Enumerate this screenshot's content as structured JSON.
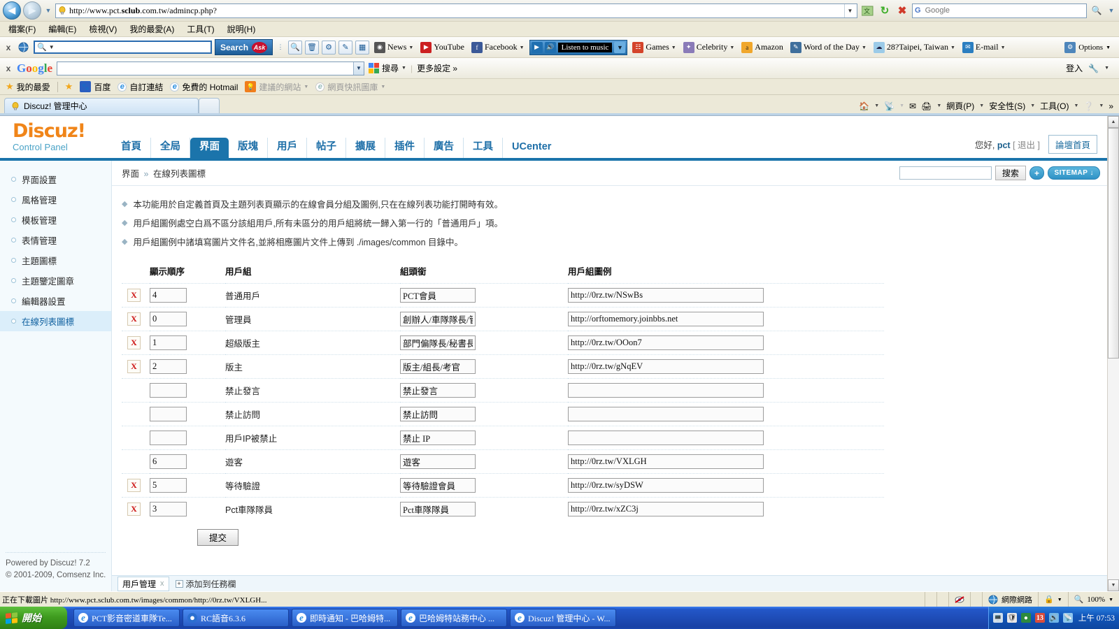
{
  "browser": {
    "address": {
      "url_prefix": "http://www.pct.",
      "url_bold": "sclub",
      "url_suffix": ".com.tw/admincp.php?"
    },
    "ie_search_placeholder": "Google",
    "menus": [
      "檔案(F)",
      "編輯(E)",
      "檢視(V)",
      "我的最愛(A)",
      "工具(T)",
      "說明(H)"
    ],
    "ask_toolbar": {
      "close": "x",
      "search_button": "Search",
      "ask_logo": "Ask",
      "items": [
        {
          "label": "News"
        },
        {
          "label": "YouTube"
        },
        {
          "label": "Facebook"
        }
      ],
      "music_label": "Listen to music",
      "items2": [
        {
          "label": "Games"
        },
        {
          "label": "Celebrity"
        },
        {
          "label": "Amazon"
        },
        {
          "label": "Word of the Day"
        },
        {
          "label": "28?Taipei, Taiwan"
        },
        {
          "label": "E-mail"
        }
      ],
      "options": "Options"
    },
    "google_toolbar": {
      "close": "x",
      "logo": "Google",
      "search_label": "搜尋",
      "more_label": "更多設定 »",
      "signin": "登入"
    },
    "favorites": {
      "label": "我的最愛",
      "items": [
        {
          "label": "百度"
        },
        {
          "label": "自訂連結"
        },
        {
          "label": "免費的 Hotmail"
        },
        {
          "label": "建議的網站"
        },
        {
          "label": "網頁快訊圖庫"
        }
      ]
    },
    "tab": {
      "title": "Discuz! 管理中心"
    },
    "command_bar": [
      "網頁(P)",
      "安全性(S)",
      "工具(O)"
    ],
    "statusbar": {
      "text": "正在下載圖片 http://www.pct.sclub.com.tw/images/common/http://0rz.tw/VXLGH...",
      "zone": "網際網路",
      "zoom": "100%"
    }
  },
  "discuz": {
    "logo_title": "Discuz!",
    "logo_sub": "Control Panel",
    "tabs": [
      {
        "label": "首頁",
        "active": false
      },
      {
        "label": "全局",
        "active": false
      },
      {
        "label": "界面",
        "active": true
      },
      {
        "label": "版塊",
        "active": false
      },
      {
        "label": "用戶",
        "active": false
      },
      {
        "label": "帖子",
        "active": false
      },
      {
        "label": "擴展",
        "active": false
      },
      {
        "label": "插件",
        "active": false
      },
      {
        "label": "廣告",
        "active": false
      },
      {
        "label": "工具",
        "active": false
      },
      {
        "label": "UCenter",
        "active": false
      }
    ],
    "user": {
      "greeting": "您好,",
      "name": "pct",
      "logout": "[ 退出 ]",
      "forum_home": "論壇首頁"
    },
    "breadcrumb": {
      "root": "界面",
      "sep": "»",
      "current": "在線列表圖標"
    },
    "search": {
      "value": "",
      "button": "搜索",
      "plus": "+",
      "sitemap": "SITEMAP ↓"
    },
    "sidebar": {
      "items": [
        {
          "label": "界面設置",
          "active": false
        },
        {
          "label": "風格管理",
          "active": false
        },
        {
          "label": "模板管理",
          "active": false
        },
        {
          "label": "表情管理",
          "active": false
        },
        {
          "label": "主題圖標",
          "active": false
        },
        {
          "label": "主題鑒定圖章",
          "active": false
        },
        {
          "label": "編輯器設置",
          "active": false
        },
        {
          "label": "在線列表圖標",
          "active": true
        }
      ],
      "footer_line1": "Powered by Discuz! 7.2",
      "footer_line2": "© 2001-2009, Comsenz Inc."
    },
    "notes": [
      "本功能用於自定義首頁及主題列表頁顯示的在線會員分組及圖例,只在在線列表功能打開時有效。",
      "用戶組圖例處空白爲不區分該組用戶,所有未區分的用戶組將統一歸入第一行的「普通用戶」項。",
      "用戶組圖例中諸填寫圖片文件名,並將相應圖片文件上傳到 ./images/common 目錄中。"
    ],
    "table": {
      "headers": {
        "del": "",
        "order": "顯示順序",
        "group": "用戶組",
        "title": "組頭銜",
        "icon": "用戶組圖例"
      },
      "rows": [
        {
          "deletable": true,
          "order": "4",
          "group": "普通用戶",
          "title": "PCT會員",
          "icon": "http://0rz.tw/NSwBs"
        },
        {
          "deletable": true,
          "order": "0",
          "group": "管理員",
          "title": "創辦人/車隊隊長/管",
          "icon": "http://orftomemory.joinbbs.net"
        },
        {
          "deletable": true,
          "order": "1",
          "group": "超級版主",
          "title": "部門偏隊長/秘書長",
          "icon": "http://0rz.tw/OOon7"
        },
        {
          "deletable": true,
          "order": "2",
          "group": "版主",
          "title": "版主/組長/考官",
          "icon": "http://0rz.tw/gNqEV"
        },
        {
          "deletable": false,
          "order": "",
          "group": "禁止發言",
          "title": "禁止發言",
          "icon": ""
        },
        {
          "deletable": false,
          "order": "",
          "group": "禁止訪問",
          "title": "禁止訪問",
          "icon": ""
        },
        {
          "deletable": false,
          "order": "",
          "group": "用戶IP被禁止",
          "title": "禁止 IP",
          "icon": ""
        },
        {
          "deletable": false,
          "order": "6",
          "group": "遊客",
          "title": "遊客",
          "icon": "http://0rz.tw/VXLGH"
        },
        {
          "deletable": true,
          "order": "5",
          "group": "等待驗證",
          "title": "等待驗證會員",
          "icon": "http://0rz.tw/syDSW"
        },
        {
          "deletable": true,
          "order": "3",
          "group": "Pct車隊隊員",
          "title": "Pct車隊隊員",
          "icon": "http://0rz.tw/xZC3j"
        }
      ],
      "delete_mark": "X"
    },
    "submit_label": "提交",
    "footer": {
      "tab_label": "用戶管理",
      "tab_close": "x",
      "add_label": "添加到任務欄",
      "plus": "+"
    }
  },
  "taskbar": {
    "start": "開始",
    "tasks": [
      {
        "label": "PCT影音密道車隊Te..."
      },
      {
        "label": "RC語音6.3.6"
      },
      {
        "label": "即時通知 - 巴哈姆特..."
      },
      {
        "label": "巴哈姆特站務中心 ..."
      },
      {
        "label": "Discuz! 管理中心 - W..."
      }
    ],
    "tray_badge": "13",
    "clock": "上午 07:53"
  }
}
